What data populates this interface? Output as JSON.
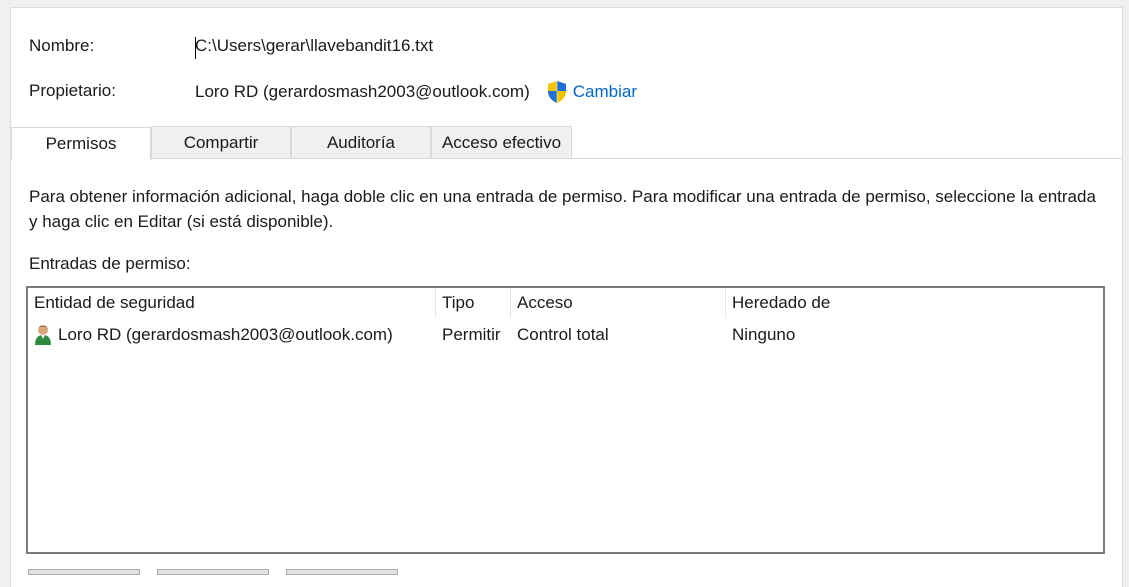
{
  "fields": {
    "name_label": "Nombre:",
    "name_value": "C:\\Users\\gerar\\llavebandit16.txt",
    "owner_label": "Propietario:",
    "owner_value": "Loro RD (gerardosmash2003@outlook.com)",
    "change_link": "Cambiar"
  },
  "tabs": [
    {
      "label": "Permisos",
      "active": true
    },
    {
      "label": "Compartir",
      "active": false
    },
    {
      "label": "Auditoría",
      "active": false
    },
    {
      "label": "Acceso efectivo",
      "active": false
    }
  ],
  "description": "Para obtener información adicional, haga doble clic en una entrada de permiso. Para modificar una entrada de permiso, seleccione la entrada y haga clic en Editar (si está disponible).",
  "entries_label": "Entradas de permiso:",
  "table": {
    "columns": [
      "Entidad de seguridad",
      "Tipo",
      "Acceso",
      "Heredado de"
    ],
    "rows": [
      {
        "principal": "Loro RD (gerardosmash2003@outlook.com)",
        "type": "Permitir",
        "access": "Control total",
        "inherited": "Ninguno",
        "icon": "user-icon"
      }
    ]
  },
  "colors": {
    "link": "#0066cc",
    "list_border": "#7a7a7a",
    "tab_inactive": "#f0f0f0"
  }
}
